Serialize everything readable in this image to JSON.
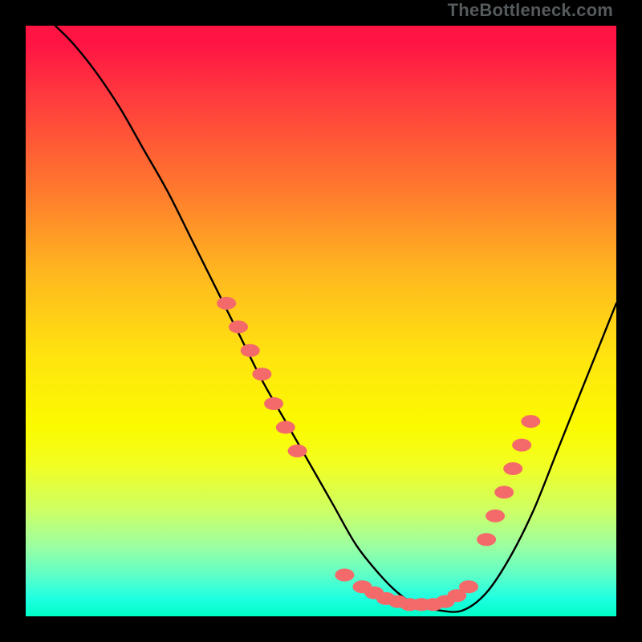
{
  "watermark": "TheBottleneck.com",
  "colors": {
    "background": "#000000",
    "gradient_top": "#ff1444",
    "gradient_bottom": "#00ffc8",
    "curve": "#000000",
    "dots": "#f46a6a"
  },
  "chart_data": {
    "type": "line",
    "title": "",
    "xlabel": "",
    "ylabel": "",
    "xlim": [
      0,
      100
    ],
    "ylim": [
      0,
      100
    ],
    "series": [
      {
        "name": "curve",
        "x": [
          5,
          8,
          12,
          16,
          20,
          24,
          28,
          32,
          36,
          40,
          44,
          48,
          52,
          56,
          60,
          63,
          66,
          70,
          74,
          78,
          82,
          86,
          90,
          94,
          98,
          100
        ],
        "y": [
          100,
          97,
          92,
          86,
          79,
          72,
          64,
          56,
          48,
          40,
          33,
          26,
          19,
          12,
          7,
          4,
          2,
          1,
          1,
          4,
          10,
          18,
          28,
          38,
          48,
          53
        ]
      }
    ],
    "annotations": {
      "highlight_dots": [
        {
          "x": 34,
          "y": 53
        },
        {
          "x": 36,
          "y": 49
        },
        {
          "x": 38,
          "y": 45
        },
        {
          "x": 40,
          "y": 41
        },
        {
          "x": 42,
          "y": 36
        },
        {
          "x": 44,
          "y": 32
        },
        {
          "x": 46,
          "y": 28
        },
        {
          "x": 54,
          "y": 7
        },
        {
          "x": 57,
          "y": 5
        },
        {
          "x": 59,
          "y": 4
        },
        {
          "x": 61,
          "y": 3
        },
        {
          "x": 63,
          "y": 2.5
        },
        {
          "x": 65,
          "y": 2
        },
        {
          "x": 67,
          "y": 2
        },
        {
          "x": 69,
          "y": 2
        },
        {
          "x": 71,
          "y": 2.5
        },
        {
          "x": 73,
          "y": 3.5
        },
        {
          "x": 75,
          "y": 5
        },
        {
          "x": 78,
          "y": 13
        },
        {
          "x": 79.5,
          "y": 17
        },
        {
          "x": 81,
          "y": 21
        },
        {
          "x": 82.5,
          "y": 25
        },
        {
          "x": 84,
          "y": 29
        },
        {
          "x": 85.5,
          "y": 33
        }
      ]
    }
  }
}
